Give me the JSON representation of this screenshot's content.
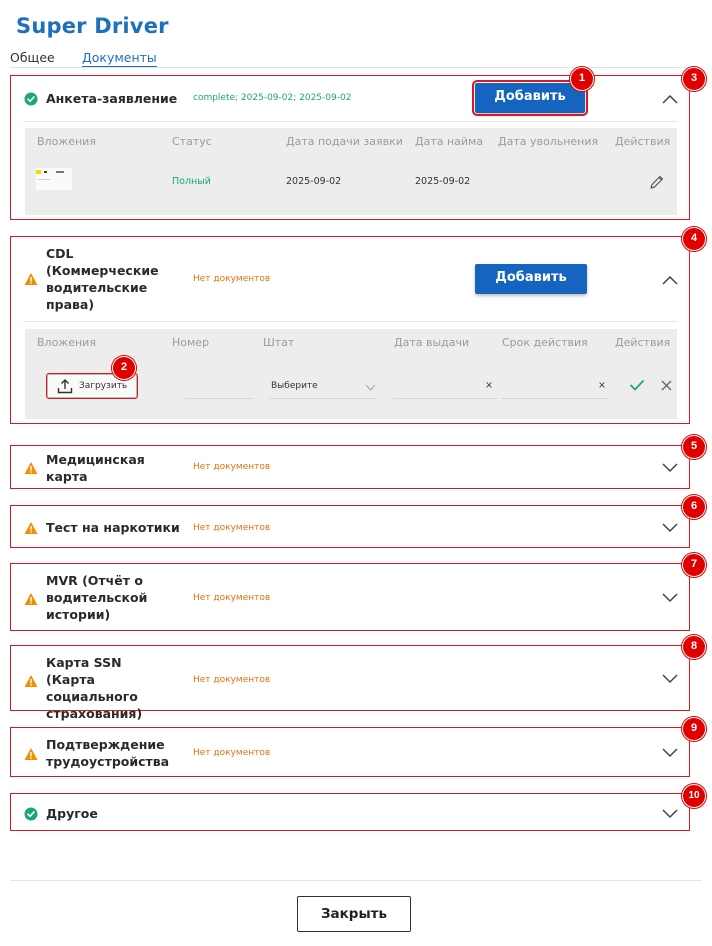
{
  "app": {
    "title": "Super Driver"
  },
  "tabs": [
    {
      "label": "Общее"
    },
    {
      "label": "Документы"
    }
  ],
  "sections": [
    {
      "name": "Анкета-заявление",
      "status": "complete; 2025-09-02; 2025-09-02",
      "status_color": "#1aa77e",
      "state": "ok",
      "add_label": "Добавить",
      "columns": [
        "Вложения",
        "Статус",
        "Дата подачи заявки",
        "Дата найма",
        "Дата увольнения",
        "Действия"
      ],
      "row": {
        "status": "Полный",
        "submitted": "2025-09-02",
        "hired": "2025-09-02"
      }
    },
    {
      "name": "CDL (Коммерческие водительские права)",
      "status": "Нет документов",
      "status_color": "#e4720c",
      "state": "warning",
      "add_label": "Добавить",
      "columns": [
        "Вложения",
        "Номер",
        "Штат",
        "Дата выдачи",
        "Срок действия",
        "Действия"
      ],
      "row": {
        "upload_label": "Загрузить",
        "state_placeholder": "Выберите",
        "clear1": "×",
        "clear2": "×"
      }
    },
    {
      "name": "Медицинская карта",
      "status": "Нет документов",
      "state": "warning"
    },
    {
      "name": "Тест на наркотики",
      "status": "Нет документов",
      "state": "warning"
    },
    {
      "name": "MVR (Отчёт о водительской истории)",
      "status": "Нет документов",
      "state": "warning"
    },
    {
      "name": "Карта SSN (Карта социального страхования)",
      "status": "Нет документов",
      "state": "warning"
    },
    {
      "name": "Подтверждение трудоустройства",
      "status": "Нет документов",
      "state": "warning"
    },
    {
      "name": "Другое",
      "status": "",
      "state": "ok"
    }
  ],
  "badges": [
    "1",
    "2",
    "3",
    "4",
    "5",
    "6",
    "7",
    "8",
    "9",
    "10"
  ],
  "footer": {
    "close_label": "Закрыть"
  },
  "colors": {
    "accent": "#1f6fbf",
    "button": "#1565c0",
    "ok": "#1aa77e",
    "warning": "#f29100",
    "highlight": "#d71920"
  }
}
